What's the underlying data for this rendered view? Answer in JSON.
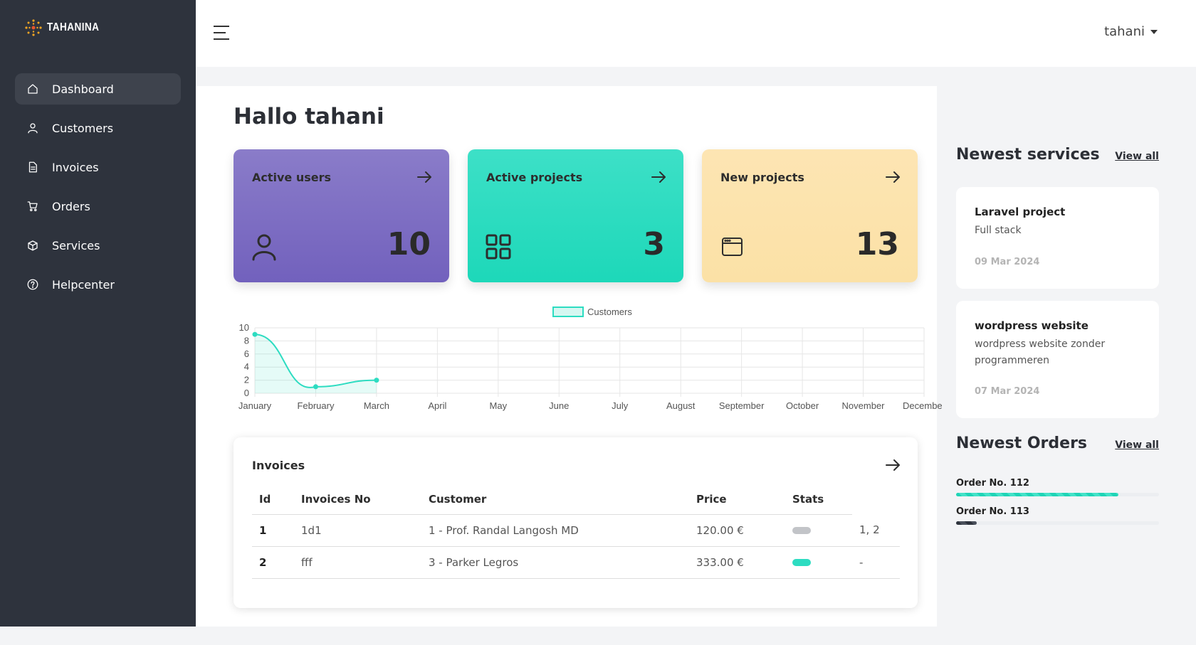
{
  "brand": {
    "name": "TAHANINA"
  },
  "sidebar": {
    "items": [
      {
        "label": "Dashboard",
        "icon": "home-icon",
        "active": true
      },
      {
        "label": "Customers",
        "icon": "user-icon",
        "active": false
      },
      {
        "label": "Invoices",
        "icon": "document-icon",
        "active": false
      },
      {
        "label": "Orders",
        "icon": "cart-icon",
        "active": false
      },
      {
        "label": "Services",
        "icon": "box-icon",
        "active": false
      },
      {
        "label": "Helpcenter",
        "icon": "help-circle-icon",
        "active": false
      }
    ]
  },
  "header": {
    "user_name": "tahani"
  },
  "main": {
    "greeting": "Hallo tahani",
    "cards": [
      {
        "title": "Active users",
        "value": "10",
        "icon": "user-icon",
        "color": "#7b6bc4"
      },
      {
        "title": "Active projects",
        "value": "3",
        "icon": "grid-icon",
        "color": "#2ddcc1"
      },
      {
        "title": "New projects",
        "value": "13",
        "icon": "browser-window-icon",
        "color": "#fce3ac"
      }
    ]
  },
  "chart_data": {
    "type": "line",
    "categories": [
      "January",
      "February",
      "March",
      "April",
      "May",
      "June",
      "July",
      "August",
      "September",
      "October",
      "November",
      "December"
    ],
    "series": [
      {
        "name": "Customers",
        "values": [
          9,
          1,
          2,
          null,
          null,
          null,
          null,
          null,
          null,
          null,
          null,
          null
        ],
        "color": "#2ddcc1"
      }
    ],
    "ylim": [
      0,
      10
    ],
    "yticks": [
      0,
      2,
      4,
      6,
      8,
      10
    ],
    "legend": "top-center",
    "grid": true,
    "title": "",
    "xlabel": "",
    "ylabel": ""
  },
  "invoices": {
    "title": "Invoices",
    "columns": [
      "Id",
      "Invoices No",
      "Customer",
      "Price",
      "Stats"
    ],
    "rows": [
      {
        "id": "1",
        "no": "1d1",
        "customer": "1 - Prof. Randal Langosh MD",
        "price": "120.00 €",
        "stat_color": "#c2c4c8",
        "extra": "1, 2"
      },
      {
        "id": "2",
        "no": "fff",
        "customer": "3 - Parker Legros",
        "price": "333.00 €",
        "stat_color": "#2ddcc1",
        "extra": "-"
      }
    ]
  },
  "services": {
    "title": "Newest services",
    "view_all": "View all",
    "items": [
      {
        "title": "Laravel project",
        "desc": "Full stack",
        "date": "09 Mar 2024"
      },
      {
        "title": "wordpress website",
        "desc": "wordpress website zonder programmeren",
        "date": "07 Mar 2024"
      }
    ]
  },
  "orders": {
    "title": "Newest Orders",
    "view_all": "View all",
    "items": [
      {
        "label": "Order No. 112",
        "progress": 0.8,
        "color": "teal"
      },
      {
        "label": "Order No. 113",
        "progress": 0.1,
        "color": "dark"
      }
    ]
  }
}
